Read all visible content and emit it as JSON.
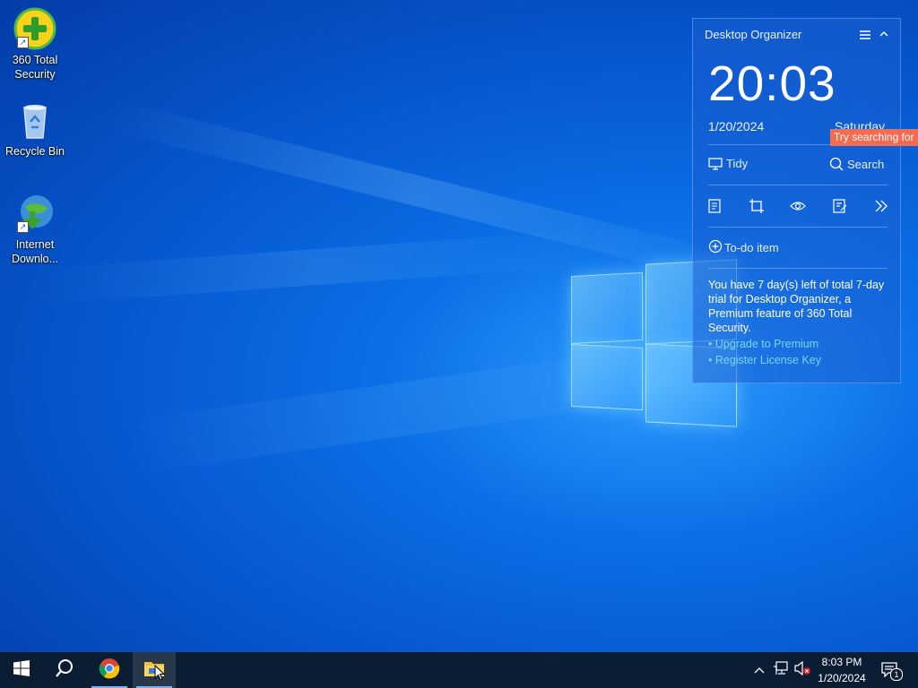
{
  "desktop": {
    "icons": [
      {
        "label": "360 Total Security"
      },
      {
        "label": "Recycle Bin"
      },
      {
        "label": "Internet Downlo..."
      }
    ]
  },
  "organizer": {
    "title": "Desktop Organizer",
    "time": "20:03",
    "date": "1/20/2024",
    "day": "Saturday",
    "tidy_label": "Tidy",
    "search_label": "Search",
    "todo_label": "To-do item",
    "trial_text": "You have 7 day(s) left of total 7-day trial for Desktop Organizer, a Premium feature of 360 Total Security.",
    "upgrade_link": "• Upgrade to Premium",
    "register_link": "• Register License Key",
    "tooltip": "Try searching for"
  },
  "taskbar": {
    "pinned": [
      {
        "icon": "windows-start-icon"
      },
      {
        "icon": "search-icon"
      },
      {
        "icon": "chrome-icon"
      },
      {
        "icon": "file-explorer-icon"
      }
    ],
    "clock_time": "8:03 PM",
    "clock_date": "1/20/2024",
    "notification_count": "1"
  },
  "colors": {
    "taskbar_bg": "#0b1d33",
    "widget_link": "#7dd4ff",
    "tooltip_bg": "#f46b4f"
  }
}
